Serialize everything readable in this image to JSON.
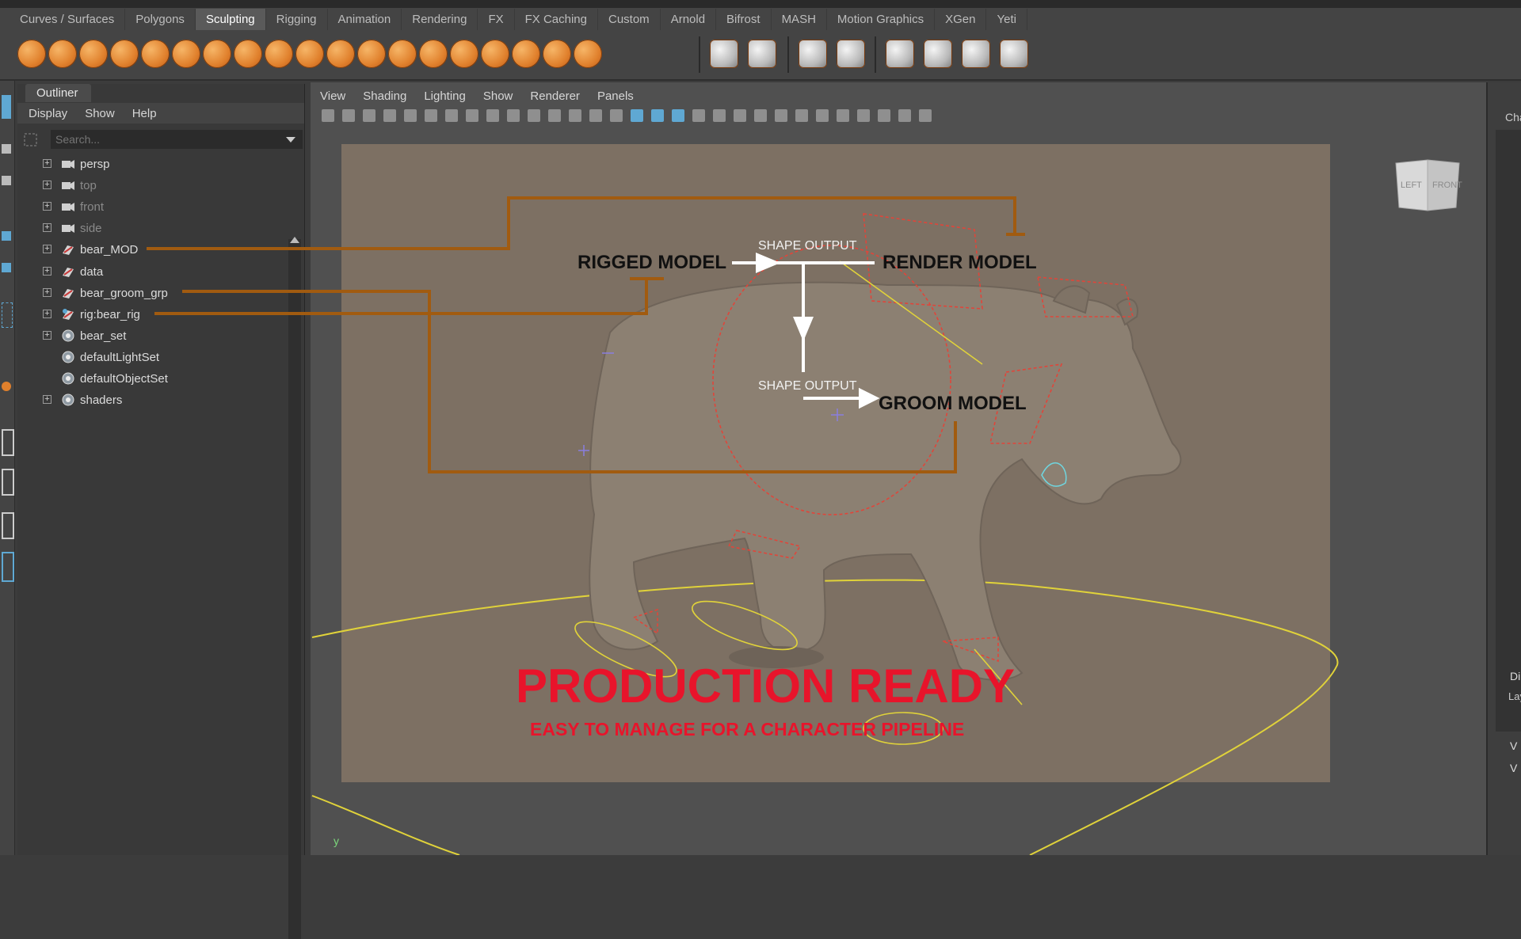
{
  "shelf": {
    "tabs": [
      "Curves / Surfaces",
      "Polygons",
      "Sculpting",
      "Rigging",
      "Animation",
      "Rendering",
      "FX",
      "FX Caching",
      "Custom",
      "Arnold",
      "Bifrost",
      "MASH",
      "Motion Graphics",
      "XGen",
      "Yeti"
    ],
    "active_tab": "Sculpting"
  },
  "outliner": {
    "title": "Outliner",
    "menu": [
      "Display",
      "Show",
      "Help"
    ],
    "search_placeholder": "Search...",
    "items": [
      {
        "label": "persp",
        "icon": "camera-icon",
        "dim": false,
        "expand": true
      },
      {
        "label": "top",
        "icon": "camera-icon",
        "dim": true,
        "expand": true
      },
      {
        "label": "front",
        "icon": "camera-icon",
        "dim": true,
        "expand": true
      },
      {
        "label": "side",
        "icon": "camera-icon",
        "dim": true,
        "expand": true
      },
      {
        "label": "bear_MOD",
        "icon": "group-icon",
        "dim": false,
        "expand": true
      },
      {
        "label": "data",
        "icon": "group-icon",
        "dim": false,
        "expand": true
      },
      {
        "label": "bear_groom_grp",
        "icon": "group-icon",
        "dim": false,
        "expand": true
      },
      {
        "label": "rig:bear_rig",
        "icon": "reference-group-icon",
        "dim": false,
        "expand": true
      },
      {
        "label": "bear_set",
        "icon": "set-icon",
        "dim": false,
        "expand": true
      },
      {
        "label": "defaultLightSet",
        "icon": "set-icon",
        "dim": false,
        "expand": false
      },
      {
        "label": "defaultObjectSet",
        "icon": "set-icon",
        "dim": false,
        "expand": false
      },
      {
        "label": "shaders",
        "icon": "set-icon",
        "dim": false,
        "expand": true
      }
    ]
  },
  "viewport": {
    "menu": [
      "View",
      "Shading",
      "Lighting",
      "Show",
      "Renderer",
      "Panels"
    ],
    "cube_left": "LEFT",
    "cube_front": "FRONT",
    "axis_label": "y"
  },
  "diagram": {
    "rigged": "RIGGED MODEL",
    "render": "RENDER MODEL",
    "groom": "GROOM MODEL",
    "shape_output_1": "SHAPE OUTPUT",
    "shape_output_2": "SHAPE OUTPUT",
    "headline": "PRODUCTION READY",
    "subhead": "EASY TO MANAGE FOR A CHARACTER PIPELINE"
  },
  "right_panel": {
    "channel_box": "Cha",
    "display": "Di",
    "layers": "Lay",
    "v1": "V",
    "v2": "V"
  },
  "colors": {
    "connector": "#a15b10",
    "headline": "#e8142b",
    "wireframe": "#e0d23a",
    "rig_lines": "#e0453a",
    "scene_bg": "#7d7063"
  }
}
